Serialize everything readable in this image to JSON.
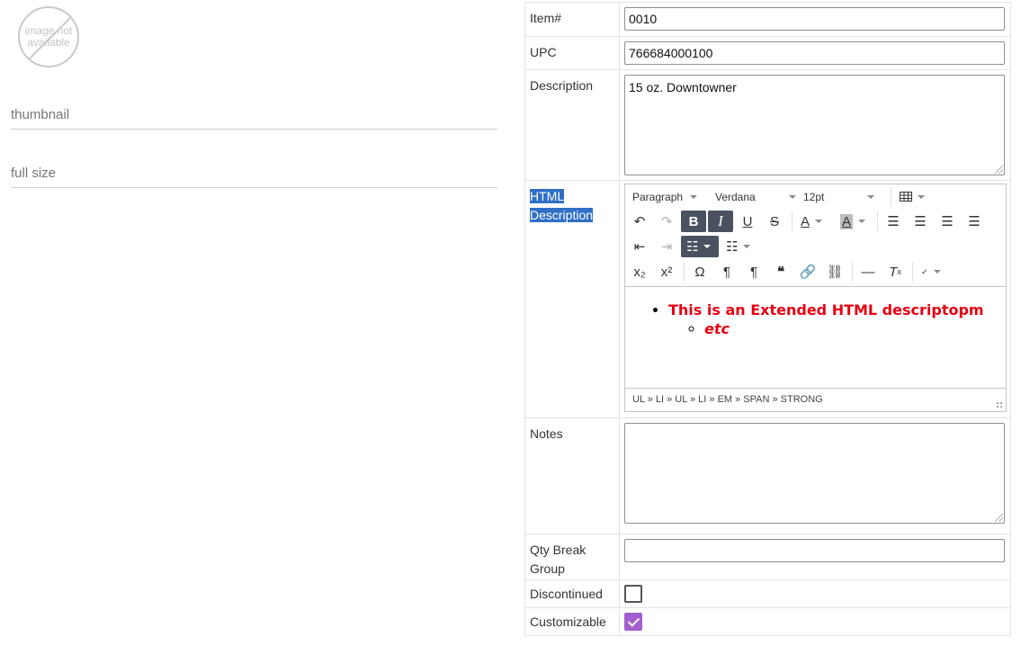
{
  "image_placeholder": {
    "text": "image not available"
  },
  "fields": {
    "thumbnail": "thumbnail",
    "full_size": "full size"
  },
  "form": {
    "item_label": "Item#",
    "item_value": "0010",
    "upc_label": "UPC",
    "upc_value": "766684000100",
    "description_label": "Description",
    "description_value": "15 oz. Downtowner",
    "html_description_label_1": "HTML",
    "html_description_label_2": "Description",
    "notes_label": "Notes",
    "notes_value": "",
    "qty_break_label": "Qty Break Group",
    "qty_break_value": "",
    "discontinued_label": "Discontinued",
    "discontinued_checked": false,
    "customizable_label": "Customizable",
    "customizable_checked": true
  },
  "editor": {
    "format_select": "Paragraph",
    "font_select": "Verdana",
    "size_select": "12pt",
    "content_item": "This is an Extended HTML descriptopm",
    "content_subitem": "etc",
    "text_color": "#e60012",
    "path": "UL » LI » UL » LI » EM » SPAN » STRONG"
  },
  "colors": {
    "selection": "#2f6fc6",
    "checkbox_checked": "#a35fcf",
    "active_button": "#4a5261"
  }
}
